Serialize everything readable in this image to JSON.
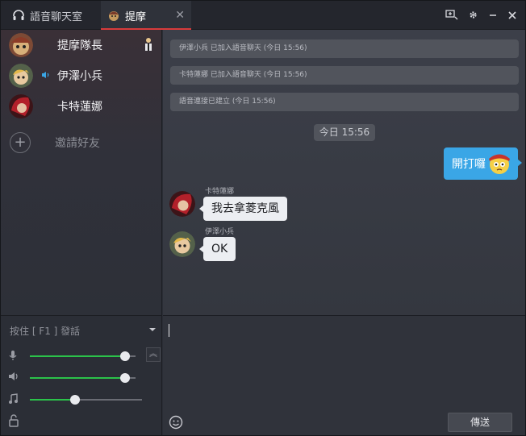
{
  "tabs": [
    {
      "label": "語音聊天室",
      "icon": "headset-icon"
    },
    {
      "label": "提摩",
      "icon": "teemo-avatar-icon",
      "active": true
    }
  ],
  "titlebar_icons": [
    "add-friend-icon",
    "gear-icon",
    "minimize-icon",
    "close-icon"
  ],
  "members": [
    {
      "name": "提摩隊長",
      "badge": "captain-badge-icon"
    },
    {
      "name": "伊澤小兵",
      "speaking": true
    },
    {
      "name": "卡特蓮娜"
    }
  ],
  "invite_label": "邀請好友",
  "system_messages": [
    "伊澤小兵 已加入語音聊天 (今日 15:56)",
    "卡特蓮娜 已加入語音聊天 (今日 15:56)",
    "語音連接已建立 (今日 15:56)"
  ],
  "timestamp": "今日 15:56",
  "my_message": {
    "text": "開打囉",
    "emoji": "teemo-emoji-icon"
  },
  "messages": [
    {
      "sender": "卡特蓮娜",
      "text": "我去拿菱克風"
    },
    {
      "sender": "伊澤小兵",
      "text": "OK"
    }
  ],
  "push_to_talk": {
    "label": "按住 [ F1 ] 發話"
  },
  "sliders": {
    "mic": {
      "level": 0.9,
      "icon": "microphone-icon",
      "color": "#2bc24a"
    },
    "speaker": {
      "level": 0.9,
      "icon": "speaker-icon",
      "color": "#2bc24a"
    },
    "music": {
      "level": 0.4,
      "icon": "music-note-icon",
      "color": "#2bc24a"
    }
  },
  "send_label": "傳送",
  "colors": {
    "accent_red": "#d83b3b",
    "bubble_blue": "#3aa6e6",
    "slider_green": "#2bc24a"
  }
}
